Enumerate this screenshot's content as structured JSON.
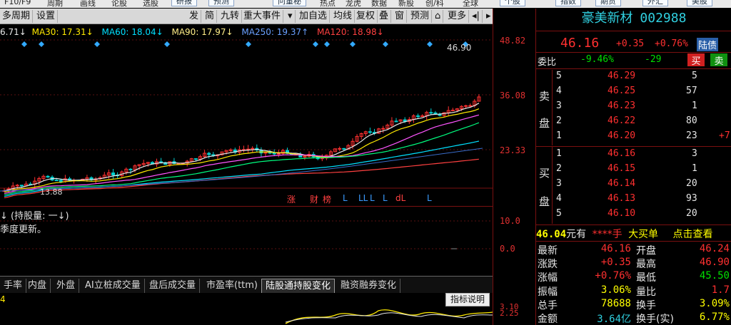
{
  "top_menu": {
    "items": [
      "F10/F9",
      "周期",
      "画线",
      "论股",
      "选股"
    ],
    "buttons": [
      "研报",
      "预测",
      "问董秘",
      "热点",
      "龙虎",
      "数据",
      "新股",
      "创/科",
      "全球",
      "个股",
      "指数",
      "期货",
      "外汇",
      "美股"
    ]
  },
  "toolbar": {
    "left": [
      "多周期",
      "设置"
    ],
    "right": [
      "发",
      "简",
      "九转",
      "重大事件",
      "▾",
      "加自选",
      "均线",
      "复权",
      "叠",
      "窗",
      "预测",
      "⌂",
      "更多",
      "◂|",
      "▸"
    ]
  },
  "ma_legend": [
    {
      "label": "6.71↓",
      "color": "#e8e8e8"
    },
    {
      "label": "MA30: 17.31↓",
      "color": "#ffea00"
    },
    {
      "label": "MA60: 18.04↓",
      "color": "#00e0ff"
    },
    {
      "label": "MA90: 17.97↓",
      "color": "#ffee88"
    },
    {
      "label": "MA250: 19.37↑",
      "color": "#6aa0ff"
    },
    {
      "label": "MA120: 18.98↓",
      "color": "#ff4040"
    }
  ],
  "price_axis": [
    "48.82",
    "36.08",
    "23.33"
  ],
  "price_tags": {
    "high": "46.90",
    "low": "13.88"
  },
  "event_marks": [
    "涨",
    "财",
    "榜",
    "L",
    "LL",
    "L",
    "L",
    "dL",
    "L"
  ],
  "holding_panel": {
    "title": "↓ (持股量: 一↓)",
    "note": "季度更新。",
    "axis": [
      "10.0",
      "0.0"
    ]
  },
  "sub_tabs": [
    "手率",
    "内盘",
    "外盘",
    "AI立桩成交量",
    "盘后成交量",
    "市盈率(ttm)",
    "陆股通持股变化",
    "融资融券变化"
  ],
  "sub_active": "陆股通持股变化",
  "indicator_help": "指标说明",
  "lower_axis": [
    "3.10",
    "2.25"
  ],
  "lower_label": "4",
  "quote": {
    "name": "豪美新材",
    "code": "002988",
    "price": "46.16",
    "change": "+0.35",
    "change_pct": "+0.76%",
    "connect_label": "陆债",
    "weibi_label": "委比",
    "weibi": "-9.46%",
    "weicha": "-29",
    "sell_btn": "买",
    "buy_btn": "卖",
    "sell_label": [
      "卖",
      "盘"
    ],
    "buy_label": [
      "买",
      "盘"
    ],
    "asks": [
      {
        "lvl": "5",
        "price": "46.29",
        "vol": "5",
        "extra": ""
      },
      {
        "lvl": "4",
        "price": "46.25",
        "vol": "57",
        "extra": ""
      },
      {
        "lvl": "3",
        "price": "46.23",
        "vol": "1",
        "extra": ""
      },
      {
        "lvl": "2",
        "price": "46.22",
        "vol": "80",
        "extra": ""
      },
      {
        "lvl": "1",
        "price": "46.20",
        "vol": "23",
        "extra": "+7"
      }
    ],
    "bids": [
      {
        "lvl": "1",
        "price": "46.16",
        "vol": "3"
      },
      {
        "lvl": "2",
        "price": "46.15",
        "vol": "1"
      },
      {
        "lvl": "3",
        "price": "46.14",
        "vol": "20"
      },
      {
        "lvl": "4",
        "price": "46.13",
        "vol": "93"
      },
      {
        "lvl": "5",
        "price": "46.10",
        "vol": "20"
      }
    ],
    "big_order": {
      "price": "46.04",
      "unit": "元有",
      "stars": "****手",
      "text": "大买单",
      "link": "点击查看"
    },
    "stats": [
      {
        "l1": "最新",
        "v1": "46.16",
        "c1": "red",
        "l2": "开盘",
        "v2": "46.24",
        "c2": "red"
      },
      {
        "l1": "涨跌",
        "v1": "+0.35",
        "c1": "red",
        "l2": "最高",
        "v2": "46.90",
        "c2": "red"
      },
      {
        "l1": "涨幅",
        "v1": "+0.76%",
        "c1": "red",
        "l2": "最低",
        "v2": "45.50",
        "c2": "green"
      },
      {
        "l1": "振幅",
        "v1": "3.06%",
        "c1": "yellow",
        "l2": "量比",
        "v2": "1.7",
        "c2": "red"
      },
      {
        "l1": "总手",
        "v1": "78688",
        "c1": "yellow",
        "l2": "换手",
        "v2": "3.09%",
        "c2": "yellow"
      },
      {
        "l1": "金额",
        "v1": "3.64亿",
        "c1": "cyan",
        "l2": "换手(实)",
        "v2": "6.77%",
        "c2": "yellow"
      }
    ]
  },
  "colors": {
    "up": "#ff3030",
    "down": "#00e000",
    "bg": "#000000",
    "grid": "#7a1010"
  }
}
